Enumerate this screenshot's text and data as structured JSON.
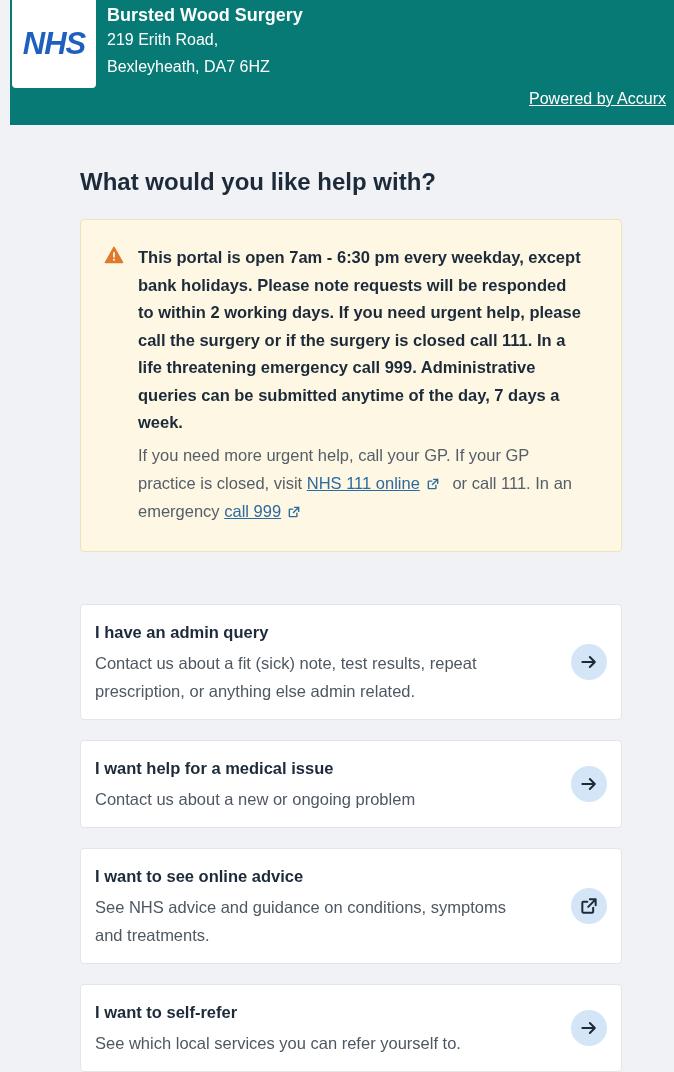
{
  "header": {
    "logo": "NHS",
    "practice_name": "Bursted Wood Surgery",
    "address_lines": [
      "219 Erith Road,",
      "Bexleyheath, DA7 6HZ"
    ],
    "powered_by": "Powered by Accurx"
  },
  "heading": "What would you like help with?",
  "notice": {
    "bold_text": "This portal is open 7am - 6:30 pm every weekday, except bank holidays. Please note requests will be responded to within 2 working days. If you need urgent help, please call the surgery or if the surgery is closed call 111. In a life threatening emergency call 999. Administrative queries can be submitted anytime of the day, 7 days a week.",
    "parts": [
      {
        "kind": "text",
        "text": "If you need more urgent help, call your GP. If your GP practice is closed, visit "
      },
      {
        "kind": "link",
        "text": "NHS 111 online"
      },
      {
        "kind": "text",
        "text": " or call 111. In an emergency "
      },
      {
        "kind": "link",
        "text": "call 999"
      }
    ]
  },
  "options": [
    {
      "title": "I have an admin query",
      "description": "Contact us about a fit (sick) note, test results, repeat prescription, or anything else admin related.",
      "kind": "arrow"
    },
    {
      "title": "I want help for a medical issue",
      "description": "Contact us about a new or ongoing problem",
      "kind": "arrow"
    },
    {
      "title": "I want to see online advice",
      "description": "See NHS advice and guidance on conditions, symptoms and treatments.",
      "kind": "external"
    },
    {
      "title": "I want to self-refer",
      "description": "See which local services you can refer yourself to.",
      "kind": "arrow"
    }
  ]
}
